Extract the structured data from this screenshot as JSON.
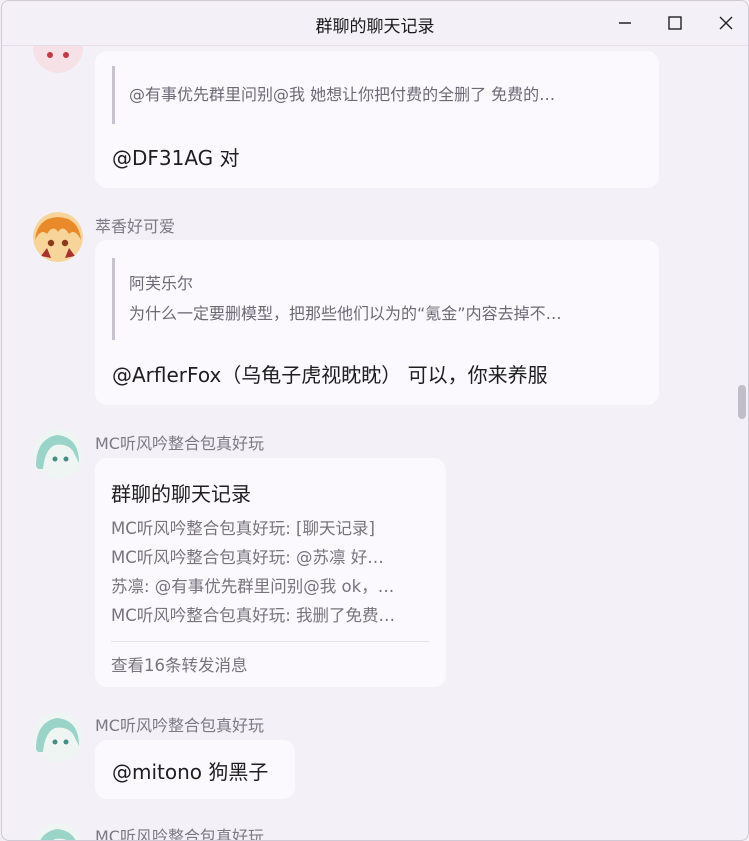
{
  "window": {
    "title": "群聊的聊天记录"
  },
  "messages": [
    {
      "quote_lines": [
        "@有事优先群里问别@我 她想让你把付费的全删了 免费的…"
      ],
      "text": "@DF31AG 对"
    },
    {
      "sender": "萃香好可爱",
      "quote_lines": [
        "阿芙乐尔",
        "为什么一定要删模型，把那些他们以为的“氪金”内容去掉不…"
      ],
      "text": "@ArflerFox（乌龟子虎视眈眈） 可以，你来养服"
    },
    {
      "sender": "MC听风吟整合包真好玩",
      "forward": {
        "title": "群聊的聊天记录",
        "lines": [
          "MC听风吟整合包真好玩: [聊天记录]",
          "MC听风吟整合包真好玩: @苏凛 好…",
          "苏凛: @有事优先群里问别@我 ok，…",
          "MC听风吟整合包真好玩: 我删了免费…"
        ],
        "footer": "查看16条转发消息"
      }
    },
    {
      "sender": "MC听风吟整合包真好玩",
      "text": "@mitono 狗黑子"
    },
    {
      "sender": "MC听风吟整合包真好玩"
    }
  ],
  "colors": {
    "background": "#f3f0f7",
    "bubble": "#fbf8fe",
    "secondary_text": "#7b7983",
    "quote_bar": "#c8c3cf"
  },
  "icons": [
    "minimize-icon",
    "maximize-icon",
    "close-icon"
  ]
}
